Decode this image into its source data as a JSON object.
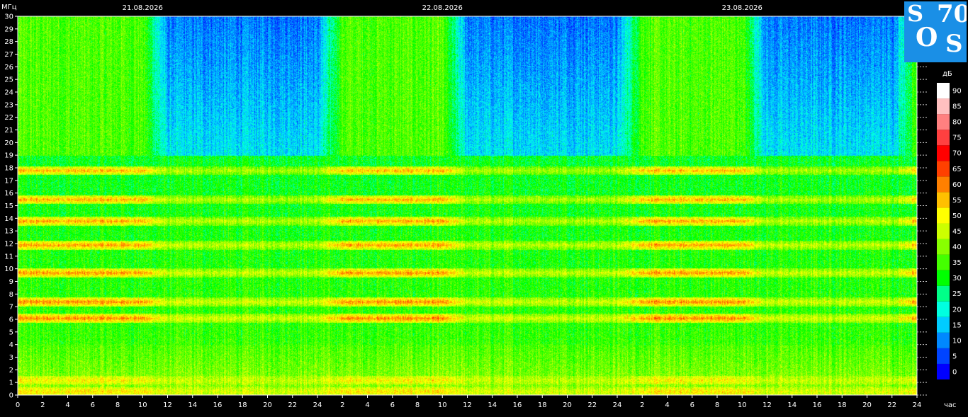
{
  "chart_data": {
    "type": "heatmap",
    "title": "",
    "ylabel": "МГц",
    "xlabel": "час",
    "colorbar_label": "дБ",
    "ylim": [
      0,
      30
    ],
    "xlim": [
      0,
      24
    ],
    "yticks": [
      0,
      1,
      2,
      3,
      4,
      5,
      6,
      7,
      8,
      9,
      10,
      11,
      12,
      13,
      14,
      15,
      16,
      17,
      18,
      19,
      20,
      21,
      22,
      23,
      24,
      25,
      26,
      27,
      28,
      29,
      30
    ],
    "xtick_labels": [
      "0",
      "2",
      "4",
      "6",
      "8",
      "10",
      "12",
      "14",
      "16",
      "18",
      "20",
      "22",
      "24",
      "2",
      "4",
      "6",
      "8",
      "10",
      "12",
      "14",
      "16",
      "18",
      "20",
      "22",
      "24",
      "2",
      "4",
      "6",
      "8",
      "10",
      "12",
      "14",
      "16",
      "18",
      "20",
      "22",
      "24"
    ],
    "date_labels": [
      {
        "text": "21.08.2026",
        "hour": 10
      },
      {
        "text": "22.08.2026",
        "hour": 34
      },
      {
        "text": "23.08.2026",
        "hour": 58
      }
    ],
    "colorbar_ticks": [
      0,
      5,
      10,
      15,
      20,
      25,
      30,
      35,
      40,
      45,
      50,
      55,
      60,
      65,
      70,
      75,
      80,
      85,
      90
    ],
    "colorbar_colors": [
      "#0000ff",
      "#0044ff",
      "#0088ff",
      "#00ccff",
      "#00ffe0",
      "#00ff88",
      "#00ff00",
      "#44ff00",
      "#88ff00",
      "#ccff00",
      "#ffff00",
      "#ffc000",
      "#ff8000",
      "#ff4000",
      "#ff0000",
      "#ff4040",
      "#ff8080",
      "#ffc0c0",
      "#ffffff"
    ],
    "resonance_bands_mhz": [
      0.3,
      1.2,
      6.1,
      7.4,
      9.7,
      11.9,
      13.8,
      15.5,
      17.8
    ],
    "daytime_regions_hours": [
      [
        10,
        26
      ],
      [
        34,
        50
      ],
      [
        58,
        72
      ]
    ]
  },
  "logo": {
    "text_s1": "S",
    "text_o": "O",
    "text_s2": "S",
    "text_70": "70"
  }
}
